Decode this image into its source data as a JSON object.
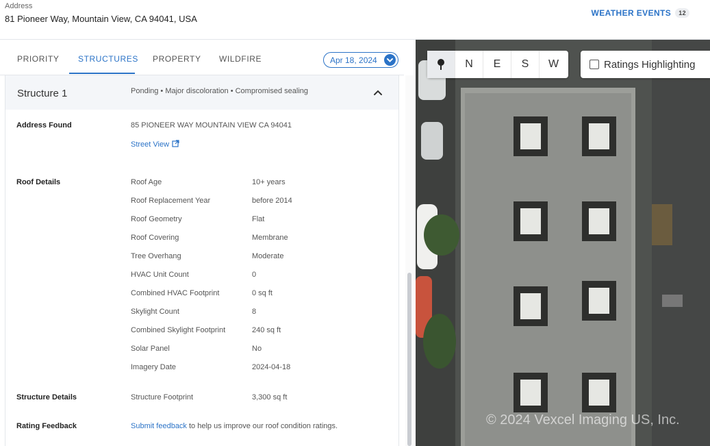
{
  "header": {
    "address_label": "Address",
    "address_value": "81 Pioneer Way, Mountain View, CA 94041, USA",
    "weather_events_label": "WEATHER EVENTS",
    "weather_events_count": "12"
  },
  "tabs": [
    {
      "label": "PRIORITY",
      "active": false
    },
    {
      "label": "STRUCTURES",
      "active": true
    },
    {
      "label": "PROPERTY",
      "active": false
    },
    {
      "label": "WILDFIRE",
      "active": false
    }
  ],
  "date_selector": {
    "value": "Apr 18, 2024"
  },
  "structure": {
    "title": "Structure 1",
    "summary": "Ponding • Major discoloration • Compromised sealing",
    "address_found_label": "Address Found",
    "address_found_value": "85 PIONEER WAY MOUNTAIN VIEW CA 94041",
    "street_view_label": "Street View",
    "roof_details_label": "Roof Details",
    "roof_details": [
      {
        "label": "Roof Age",
        "value": "10+ years"
      },
      {
        "label": "Roof Replacement Year",
        "value": "before 2014"
      },
      {
        "label": "Roof Geometry",
        "value": "Flat"
      },
      {
        "label": "Roof Covering",
        "value": "Membrane"
      },
      {
        "label": "Tree Overhang",
        "value": "Moderate"
      },
      {
        "label": "HVAC Unit Count",
        "value": "0"
      },
      {
        "label": "Combined HVAC Footprint",
        "value": "0 sq ft"
      },
      {
        "label": "Skylight Count",
        "value": "8"
      },
      {
        "label": "Combined Skylight Footprint",
        "value": "240 sq ft"
      },
      {
        "label": "Solar Panel",
        "value": "No"
      },
      {
        "label": "Imagery Date",
        "value": "2024-04-18"
      }
    ],
    "structure_details_label": "Structure Details",
    "structure_footprint_label": "Structure Footprint",
    "structure_footprint_value": "3,300 sq ft",
    "rating_feedback_label": "Rating Feedback",
    "submit_feedback_link": "Submit feedback",
    "feedback_text": " to help us improve our roof condition ratings."
  },
  "map": {
    "compass": [
      "N",
      "E",
      "S",
      "W"
    ],
    "ratings_highlighting_label": "Ratings Highlighting",
    "watermark": "© 2024 Vexcel Imaging US, Inc.",
    "icons": {
      "pin": "map-pin-icon",
      "collapse": "chevron-up-icon",
      "external": "external-link-icon",
      "caret": "chevron-down-icon"
    }
  }
}
